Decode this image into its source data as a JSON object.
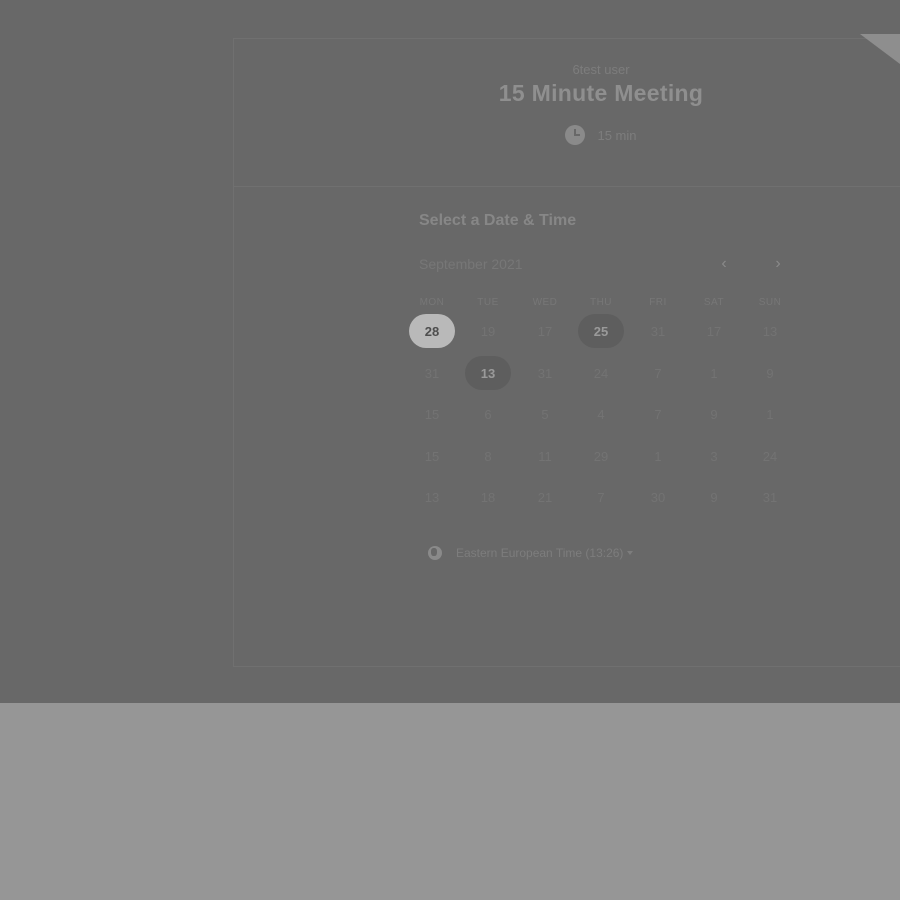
{
  "event": {
    "user_name": "6test user",
    "title": "15 Minute Meeting",
    "duration": "15 min"
  },
  "scheduler": {
    "section_title": "Select a Date & Time",
    "month_label": "September 2021",
    "prev_icon": "chevron-left-icon",
    "next_icon": "chevron-right-icon",
    "weekdays": [
      "MON",
      "TUE",
      "WED",
      "THU",
      "FRI",
      "SAT",
      "SUN"
    ],
    "weeks": [
      [
        "28",
        "19",
        "17",
        "25",
        "31",
        "17",
        "13"
      ],
      [
        "31",
        "13",
        "31",
        "24",
        "7",
        "1",
        "9"
      ],
      [
        "15",
        "6",
        "5",
        "4",
        "7",
        "9",
        "1"
      ],
      [
        "15",
        "8",
        "11",
        "29",
        "1",
        "3",
        "24"
      ],
      [
        "13",
        "18",
        "21",
        "7",
        "30",
        "9",
        "31"
      ]
    ],
    "selected_day": "28",
    "available_days": [
      "25",
      "13"
    ]
  },
  "timezone": {
    "label": "Eastern European Time (13:26)",
    "icon": "globe-icon"
  },
  "colors": {
    "overlay": "#686868",
    "page": "#969696",
    "selected": "#b9b9b9"
  }
}
